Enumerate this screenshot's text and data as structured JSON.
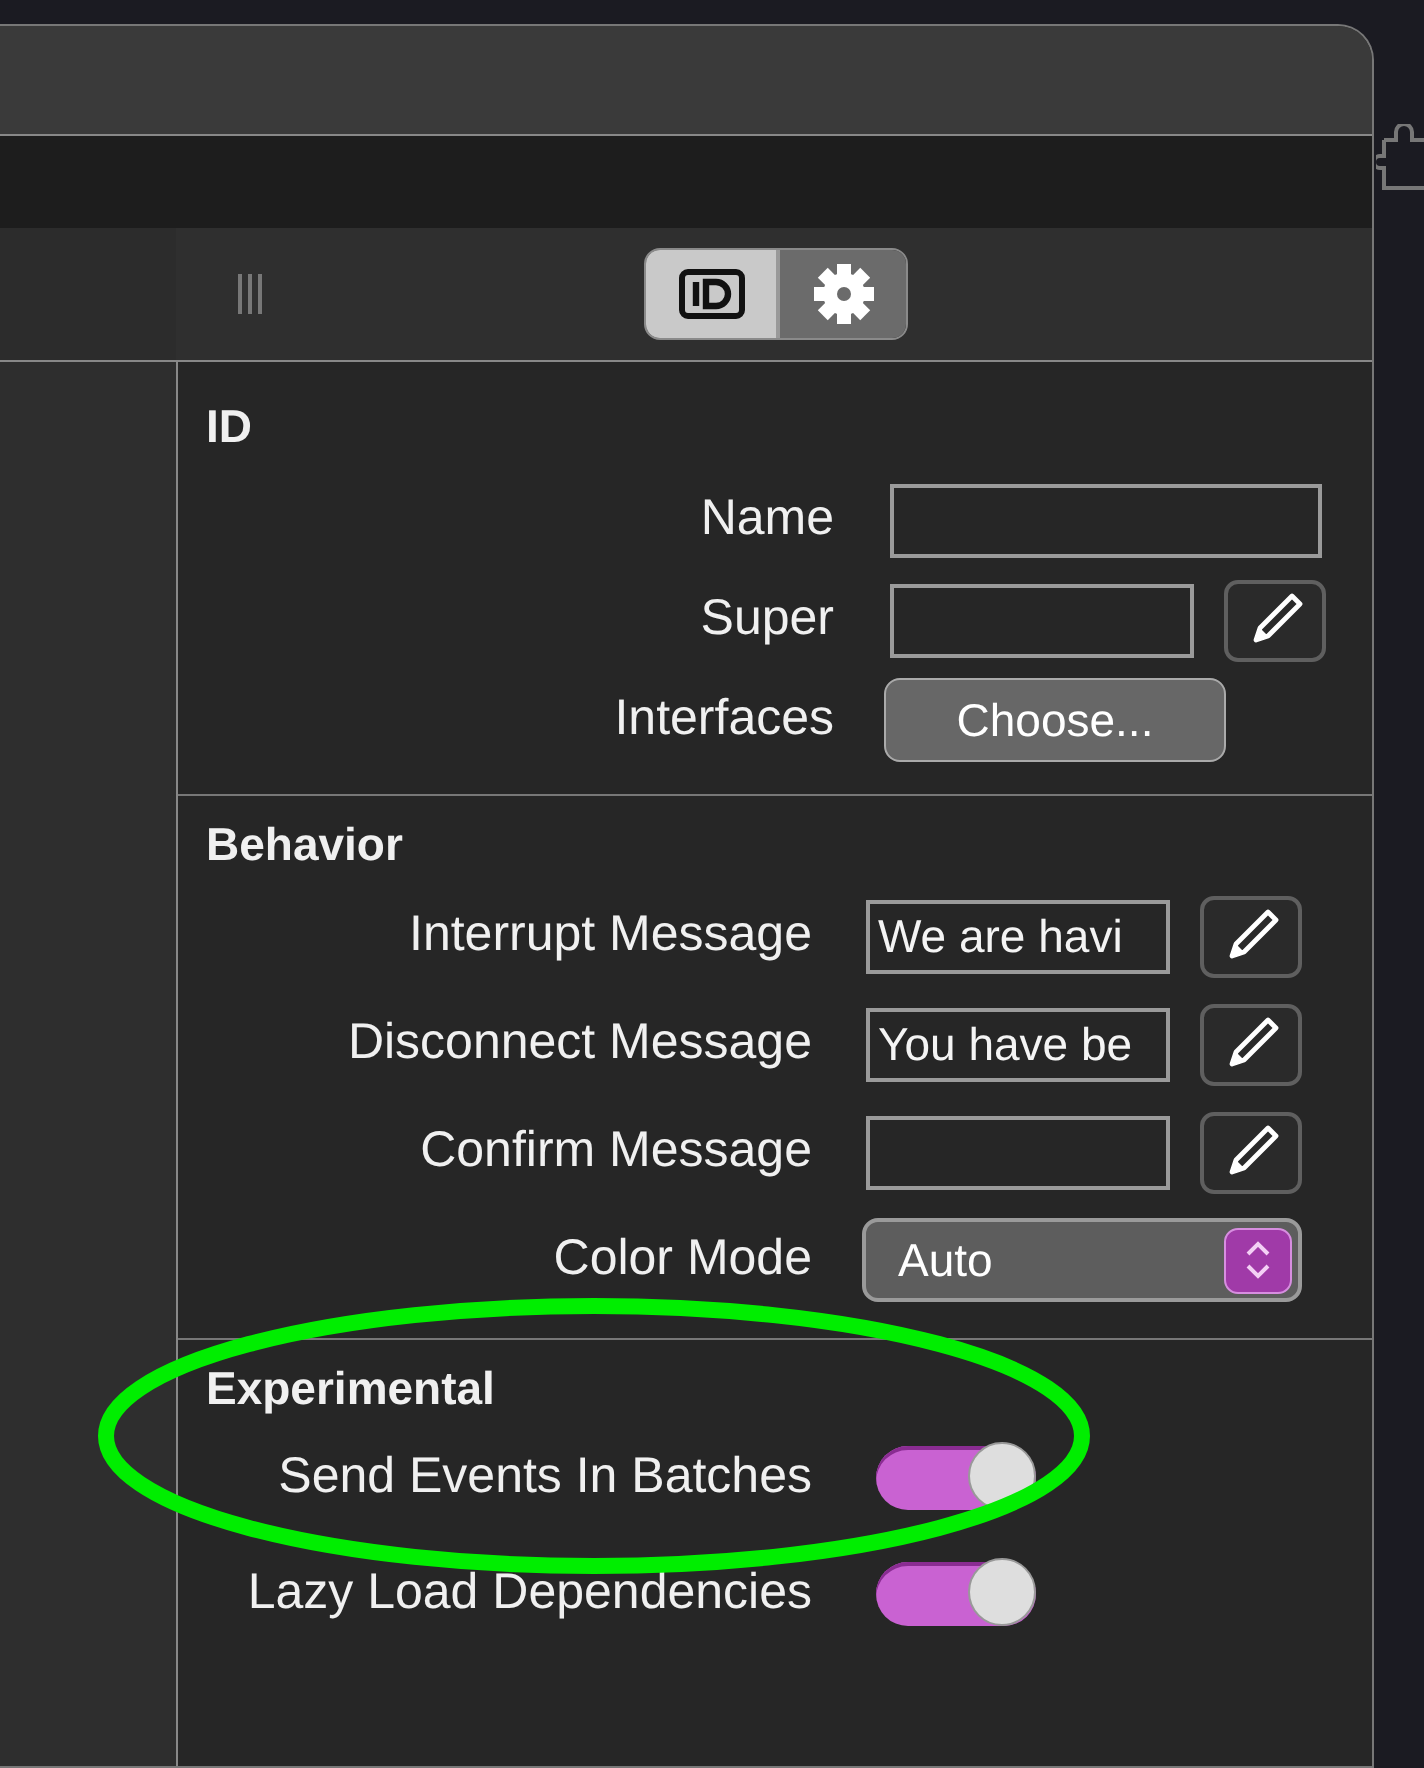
{
  "inspector_tabs": [
    {
      "kind": "id",
      "selected": true
    },
    {
      "kind": "settings",
      "selected": false
    }
  ],
  "sections": [
    {
      "title": "ID",
      "rows": [
        {
          "kind": "field",
          "label": "Name"
        },
        {
          "kind": "field_edit",
          "label": "Super"
        },
        {
          "kind": "button",
          "label": "Interfaces",
          "button": "Choose..."
        }
      ]
    },
    {
      "title": "Behavior",
      "rows": [
        {
          "kind": "field_edit",
          "label": "Interrupt Message",
          "value": "We are havi"
        },
        {
          "kind": "field_edit",
          "label": "Disconnect Message",
          "value": "You have be"
        },
        {
          "kind": "field_edit",
          "label": "Confirm Message"
        },
        {
          "kind": "select",
          "label": "Color Mode",
          "value": "Auto"
        }
      ]
    },
    {
      "title": "Experimental",
      "rows": [
        {
          "kind": "toggle",
          "label": "Send Events In Batches",
          "on": true
        },
        {
          "kind": "toggle",
          "label": "Lazy Load Dependencies",
          "on": true
        }
      ]
    }
  ]
}
